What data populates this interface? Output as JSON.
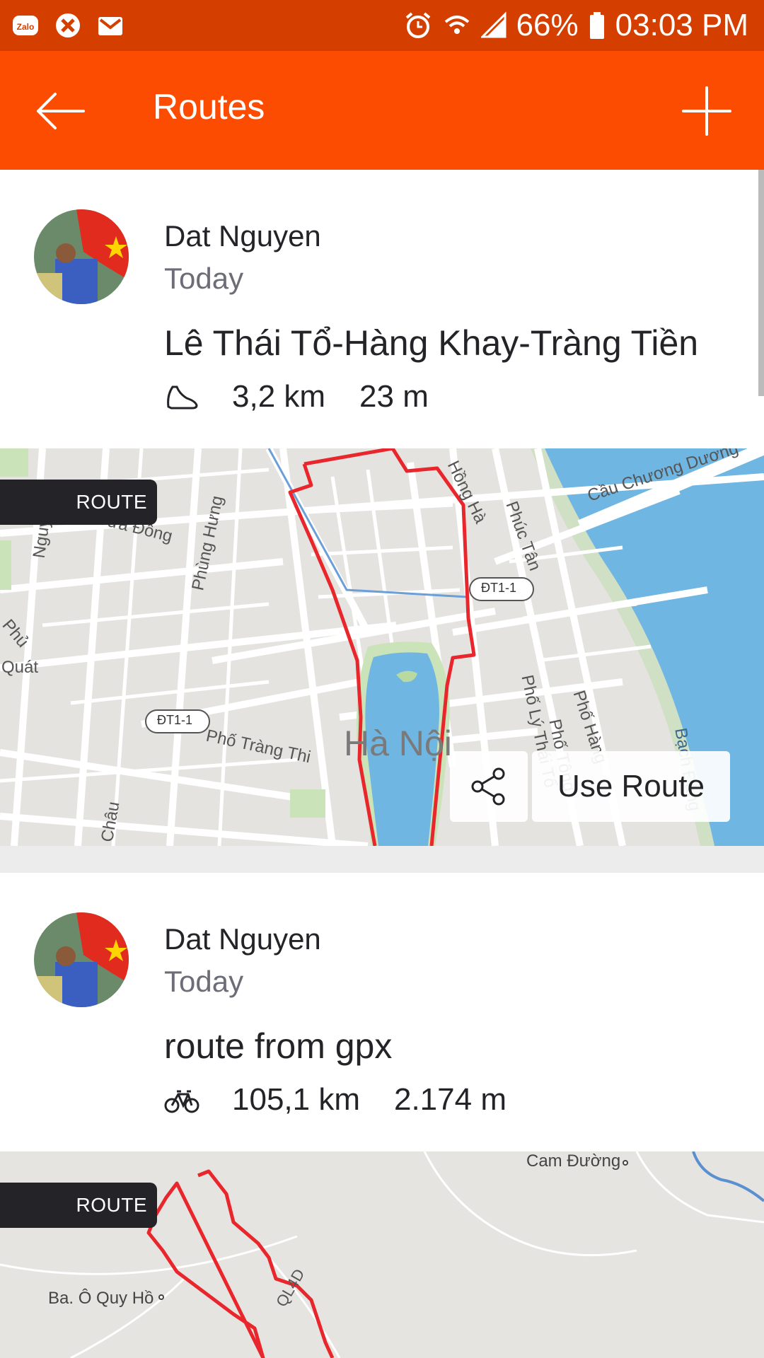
{
  "status_bar": {
    "left_icons": [
      "zalo-icon",
      "x-app-icon",
      "gmail-icon"
    ],
    "alarm_icon": "alarm-icon",
    "wifi_icon": "wifi-icon",
    "signal_icon": "signal-icon",
    "battery_percent": "66%",
    "time": "03:03 PM"
  },
  "app_bar": {
    "title": "Routes",
    "back_icon": "arrow-left-icon",
    "add_icon": "plus-icon",
    "background": "#fc4c02"
  },
  "routes": [
    {
      "author": "Dat Nguyen",
      "date": "Today",
      "title": "Lê Thái Tổ-Hàng Khay-Tràng Tiền",
      "sport_icon": "run-shoe-icon",
      "distance": "3,2 km",
      "elevation": "23 m",
      "badge": "ROUTE",
      "use_route_label": "Use Route",
      "share_icon": "share-icon",
      "map_labels": [
        "Hà Nội",
        "Cửa Đông",
        "Phùng Hưng",
        "Phố Tràng Thi",
        "ĐT1-1",
        "ĐT1-1",
        "Hồng Hà",
        "Phúc Tân",
        "Cầu Chương Dương",
        "Nguyễn",
        "Quát",
        "Phố Lý Thái Tổ",
        "Phố Tông",
        "Châu",
        "Phủ",
        "Phố Hàng",
        "Bạch Đằng"
      ]
    },
    {
      "author": "Dat Nguyen",
      "date": "Today",
      "title": "route from gpx",
      "sport_icon": "bike-icon",
      "distance": "105,1 km",
      "elevation": "2.174 m",
      "badge": "ROUTE",
      "map_labels": [
        "Cam Đường",
        "Ba. Ô Quy Hồ",
        "QL4D"
      ]
    }
  ],
  "colors": {
    "accent": "#fc4c02",
    "status_bar": "#d43f00",
    "route_line": "#e8262b",
    "water": "#6fb6e2"
  }
}
